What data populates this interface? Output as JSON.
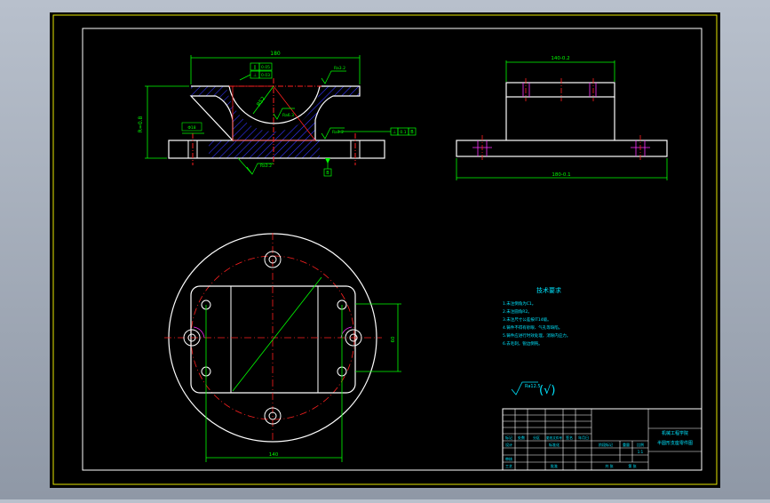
{
  "drawing": {
    "colors": {
      "background": "#000000",
      "frame": "#e6e600",
      "outline": "#ffffff",
      "dimension": "#00ff00",
      "centerline": "#ff2020",
      "hatch": "#3333ff",
      "text": "#00e5ff",
      "hidden": "#ff33ff"
    },
    "front_view": {
      "dim_top": "180",
      "dim_left": "R=0.8",
      "dim_r": "R52",
      "dim_hole": "Φ18",
      "rough1": "Ra3.2",
      "rough2": "Ra6.3",
      "rough3": "Ra3.2",
      "rough4": "Ra3.2",
      "gtol1_a": "∥",
      "gtol1_b": "0.05",
      "gtol2_a": "⊥",
      "gtol2_b": "0.03",
      "gtol3_a": "⊥",
      "gtol3_b": "0.1",
      "gtol3_c": "B",
      "datum": "B"
    },
    "side_view": {
      "dim_top": "140-0.2",
      "dim_bottom": "180-0.1"
    },
    "plan_view": {
      "dim_bottom": "140",
      "dim_right": "60"
    },
    "notes": {
      "title": "技术要求",
      "items": [
        "1.未注倒角为C1。",
        "2.未注圆角R2。",
        "3.未注尺寸公差按IT14级。",
        "4.铸件不得有砂眼、气孔等缺陷。",
        "5.铸件应进行时效处理，消除内应力。",
        "6.去毛刺，锐边倒钝。"
      ]
    },
    "roughness_mark": {
      "value": "Ra12.5",
      "suffix": "(√)"
    },
    "title_block": {
      "school": "机械工程学院",
      "part_name": "半圆形支座零件图",
      "cells": {
        "mark": "标记",
        "count": "处数",
        "zone": "分区",
        "doc_no": "更改文件号",
        "sign": "签名",
        "date": "年月日",
        "design": "设计",
        "standard": "标准化",
        "review": "审核",
        "process": "工艺",
        "approve": "批准",
        "stage": "阶段标记",
        "weight": "重量",
        "scale": "比例",
        "scale_val": "1:1",
        "sheets": "共 张",
        "sheet_no": "第 张"
      }
    }
  }
}
